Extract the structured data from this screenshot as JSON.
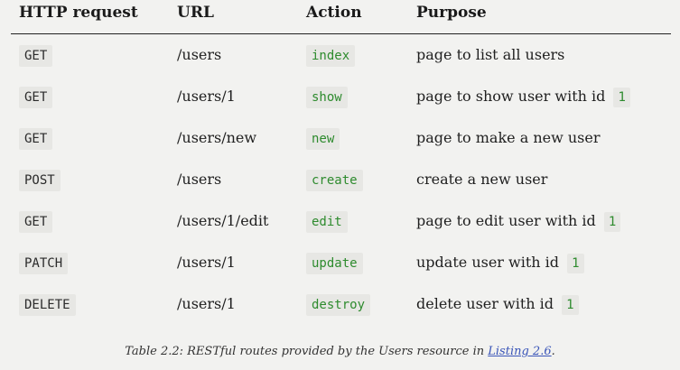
{
  "table": {
    "headers": {
      "method": "HTTP request",
      "url": "URL",
      "action": "Action",
      "purpose": "Purpose"
    },
    "rows": [
      {
        "method": "GET",
        "url": "/users",
        "action": "index",
        "purpose": "page to list all users",
        "id": ""
      },
      {
        "method": "GET",
        "url": "/users/1",
        "action": "show",
        "purpose": "page to show user with id",
        "id": "1"
      },
      {
        "method": "GET",
        "url": "/users/new",
        "action": "new",
        "purpose": "page to make a new user",
        "id": ""
      },
      {
        "method": "POST",
        "url": "/users",
        "action": "create",
        "purpose": "create a new user",
        "id": ""
      },
      {
        "method": "GET",
        "url": "/users/1/edit",
        "action": "edit",
        "purpose": "page to edit user with id",
        "id": "1"
      },
      {
        "method": "PATCH",
        "url": "/users/1",
        "action": "update",
        "purpose": "update user with id",
        "id": "1"
      },
      {
        "method": "DELETE",
        "url": "/users/1",
        "action": "destroy",
        "purpose": "delete user with id",
        "id": "1"
      }
    ]
  },
  "caption": {
    "prefix": "Table 2.2:  RESTful routes provided by the Users resource in ",
    "link": "Listing 2.6",
    "suffix": "."
  },
  "colors": {
    "background": "#f2f2f0",
    "code_background": "#e7e7e4",
    "action_green": "#2e8b2e",
    "link_blue": "#3a55b8"
  }
}
